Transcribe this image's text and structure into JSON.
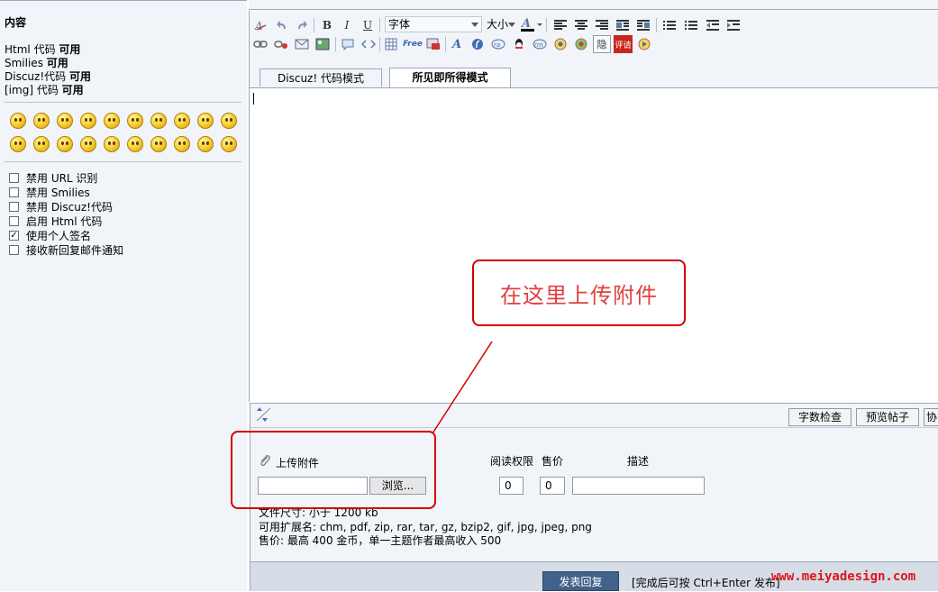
{
  "sidebar": {
    "title": "内容",
    "features": [
      {
        "name": "Html 代码",
        "status": "可用"
      },
      {
        "name": "Smilies",
        "status": "可用"
      },
      {
        "name": "Discuz!代码",
        "status": "可用"
      },
      {
        "name": "[img] 代码",
        "status": "可用"
      }
    ],
    "options": [
      {
        "label": "禁用 URL 识别",
        "checked": false
      },
      {
        "label": "禁用 Smilies",
        "checked": false
      },
      {
        "label": "禁用 Discuz!代码",
        "checked": false
      },
      {
        "label": "启用 Html 代码",
        "checked": false
      },
      {
        "label": "使用个人签名",
        "checked": true
      },
      {
        "label": "接收新回复邮件通知",
        "checked": false
      }
    ]
  },
  "toolbar": {
    "font_select": "字体",
    "size_select": "大小",
    "bold": "B",
    "italic": "I",
    "underline": "U",
    "free_icon": "Free",
    "hide_icon": "隐",
    "rate_icon": "评请"
  },
  "tabs": {
    "discuz_mode": "Discuz! 代码模式",
    "wysiwyg_mode": "所见即所得模式"
  },
  "editor_buttons": {
    "word_check": "字数检查",
    "preview": "预览帖子",
    "more": "协"
  },
  "attachments": {
    "upload_label": "上传附件",
    "browse": "浏览...",
    "col_read_perm": "阅读权限",
    "col_price": "售价",
    "col_desc": "描述",
    "read_perm_value": "0",
    "price_value": "0",
    "desc_value": "",
    "file_size": "文件尺寸: 小于 1200 kb",
    "extensions": "可用扩展名: chm, pdf, zip, rar, tar, gz, bzip2, gif, jpg, jpeg, png",
    "price_note": "售价: 最高 400 金币，单一主题作者最高收入 500"
  },
  "footer": {
    "submit": "发表回复",
    "hint": "[完成后可按 Ctrl+Enter 发布]",
    "watermark": "www.meiyadesign.com"
  },
  "annotation": {
    "callout_text": "在这里上传附件"
  },
  "colors": {
    "annotation_red": "#d40000",
    "panel_bg": "#f1f4f8",
    "submit_bg": "#41628b"
  }
}
